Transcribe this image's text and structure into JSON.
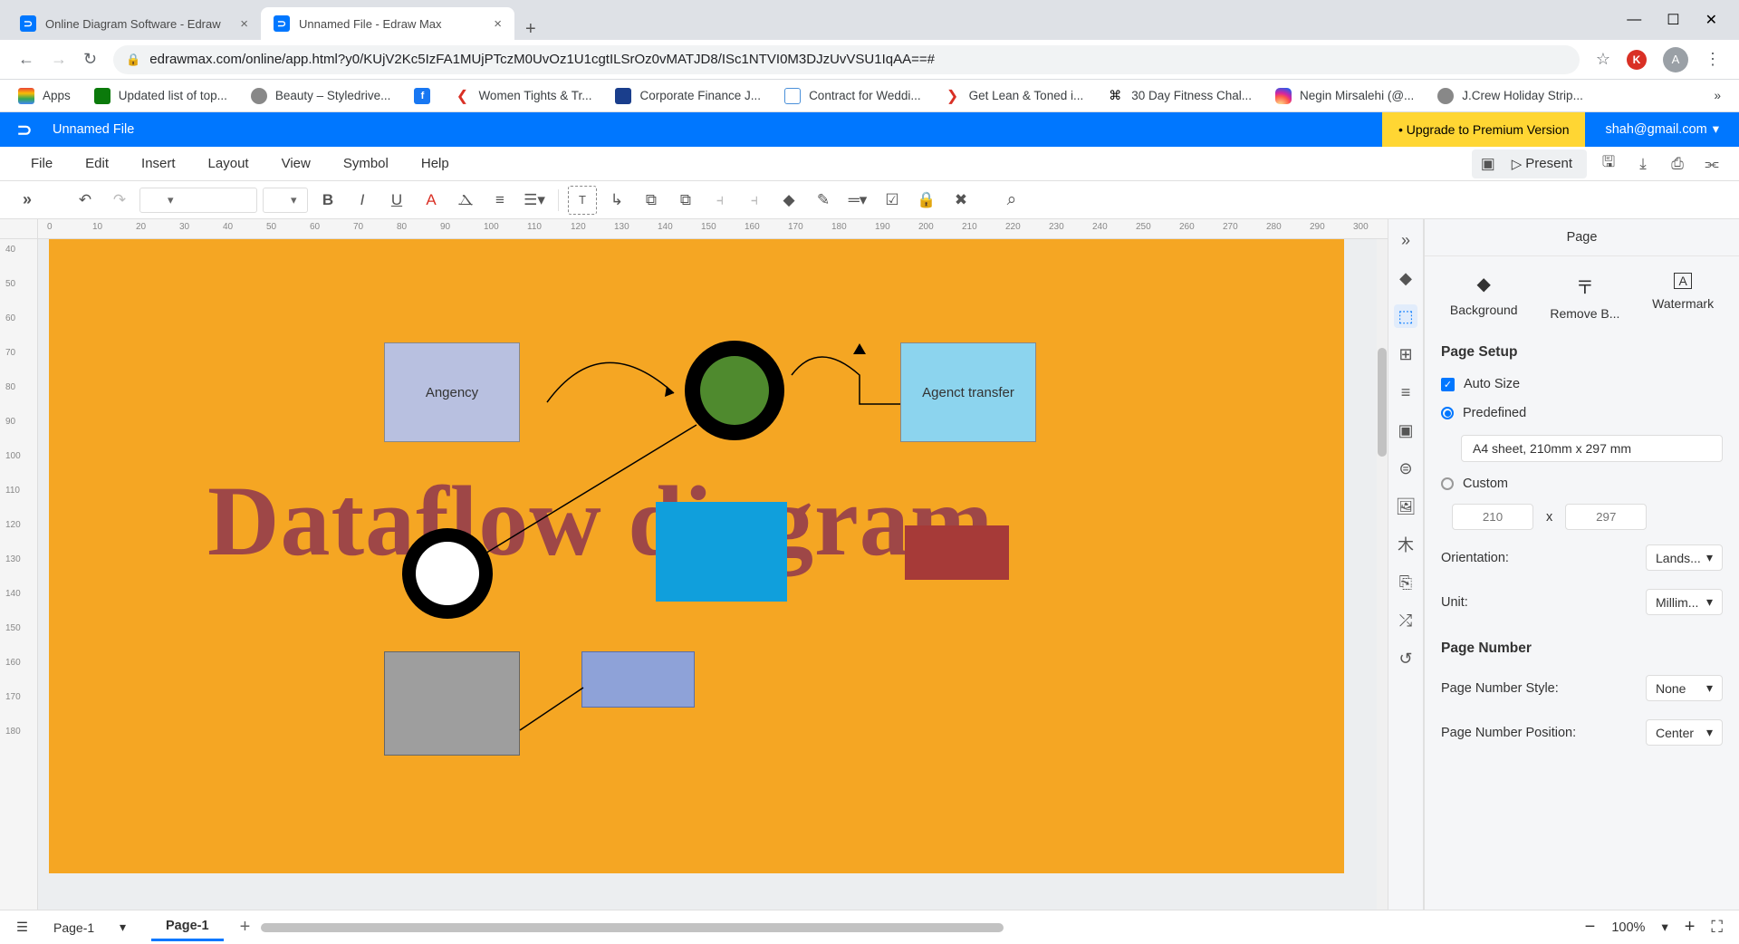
{
  "browser": {
    "tabs": [
      {
        "title": "Online Diagram Software - Edraw",
        "favicon_color": "#0077ff",
        "favicon_letter": "⊃"
      },
      {
        "title": "Unnamed File - Edraw Max",
        "favicon_color": "#0077ff",
        "favicon_letter": "⊃"
      }
    ],
    "url": "edrawmax.com/online/app.html?y0/KUjV2Kc5IzFA1MUjPTczM0UvOz1U1cgtILSrOz0vMATJD8/ISc1NTVI0M3DJzUvVSU1IqAA==#",
    "avatar_letter": "A",
    "kbadge": "K"
  },
  "bookmarks": [
    {
      "label": "Apps",
      "color": ""
    },
    {
      "label": "Updated list of top...",
      "color": "#0b7a0b"
    },
    {
      "label": "Beauty – Styledrive...",
      "color": "#888"
    },
    {
      "label": "",
      "color": "#1877f2"
    },
    {
      "label": "Women Tights & Tr...",
      "color": "#d93025"
    },
    {
      "label": "Corporate Finance J...",
      "color": "#1a3e8c"
    },
    {
      "label": "Contract for Weddi...",
      "color": "#f5a623"
    },
    {
      "label": "Get Lean & Toned i...",
      "color": "#d93025"
    },
    {
      "label": "30 Day Fitness Chal...",
      "color": "#000"
    },
    {
      "label": "Negin Mirsalehi (@...",
      "color": "#d62976"
    },
    {
      "label": "J.Crew Holiday Strip...",
      "color": "#888"
    }
  ],
  "app": {
    "filename": "Unnamed File",
    "upgrade": "• Upgrade to Premium Version",
    "user": "shah@gmail.com"
  },
  "menu": [
    "File",
    "Edit",
    "Insert",
    "Layout",
    "View",
    "Symbol",
    "Help"
  ],
  "present": "Present",
  "canvas": {
    "title_text": "Dataflow diagram",
    "shape1_label": "Angency",
    "shape2_label": "Agenct transfer"
  },
  "right": {
    "title": "Page",
    "tabs": [
      "Background",
      "Remove B...",
      "Watermark"
    ],
    "setup": "Page Setup",
    "autosize": "Auto Size",
    "predefined": "Predefined",
    "predef_value": "A4 sheet, 210mm x 297 mm",
    "custom": "Custom",
    "w": "210",
    "h": "297",
    "x": "x",
    "orientation": "Orientation:",
    "orient_val": "Lands...",
    "unit": "Unit:",
    "unit_val": "Millim...",
    "pagenum": "Page Number",
    "pn_style": "Page Number Style:",
    "pn_style_val": "None",
    "pn_pos": "Page Number Position:",
    "pn_pos_val": "Center"
  },
  "status": {
    "page_sel": "Page-1",
    "page_tab": "Page-1",
    "zoom": "100%"
  }
}
